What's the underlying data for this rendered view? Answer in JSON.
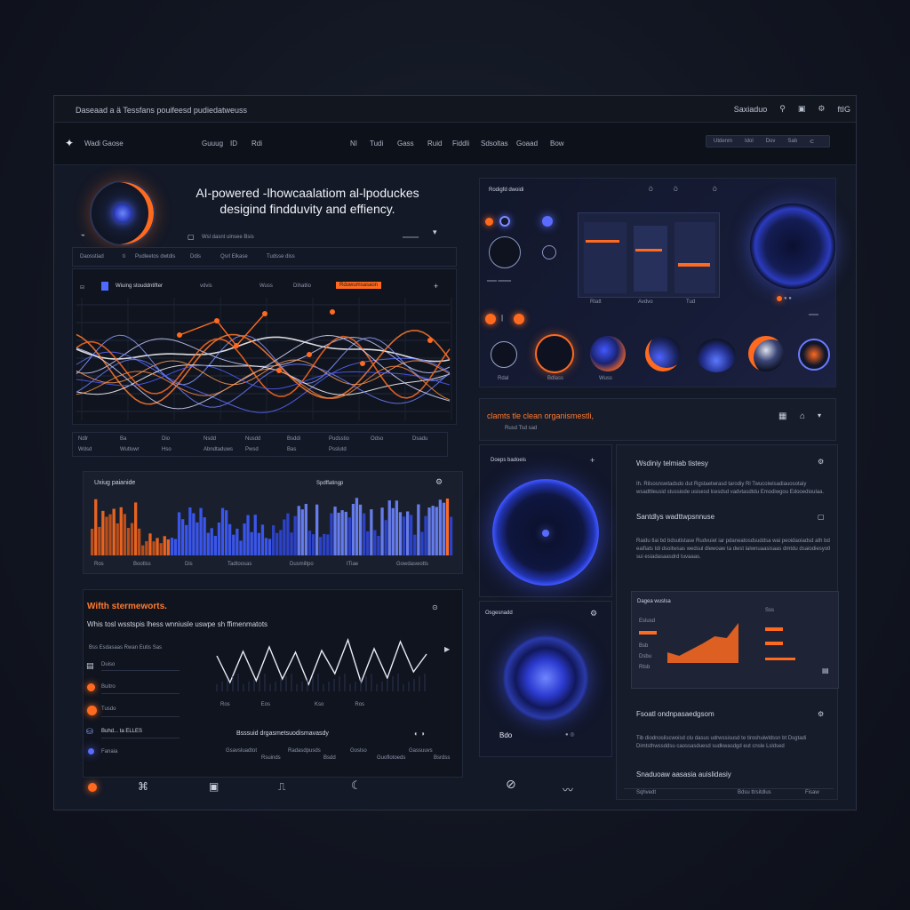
{
  "titlebar": {
    "title": "Daseaad  a  ä  Tessfans pouifeesd pudiedatweuss",
    "right_label": "Saxiaduo",
    "right_badge": "ftIG"
  },
  "navbar": {
    "brand": "Wadi Gaose",
    "items": [
      "Guuug",
      "ID",
      "Rdi",
      "NI",
      "Tudi",
      "Gass",
      "Ruid",
      "Fiddli",
      "Sdsoltas",
      "Goaad",
      "Bow"
    ],
    "search_items": [
      "Utdenm",
      "Idol",
      "Dov",
      "Sab"
    ]
  },
  "hero": {
    "title_line1": "AI-powered -lhowcaalatiom al-lpoduckes",
    "title_line2": "desigind findduvity and effiency.",
    "caption": "Wsl dasnt ulnsee Bsis",
    "toolbar": [
      "Daosstiad",
      "ti",
      "Pudleetos dwtdis",
      "Ddis",
      "Qsrl Elkase",
      "Tudsse diss"
    ]
  },
  "wave_chart": {
    "legend": [
      "Wiuing stouddntifter",
      "vdvis",
      "Wuss",
      "Dihatlio"
    ],
    "badge": "Rduwumsasaon",
    "footer_cols": [
      [
        "Ndlr",
        "Wdsd"
      ],
      [
        "Ba",
        "Wutluwr"
      ],
      [
        "Dio",
        "Hso"
      ],
      [
        "Nsdd",
        "Abndtaduws"
      ],
      [
        "Nusdd",
        "Pwsd"
      ],
      [
        "Bsddi",
        "Bas"
      ],
      [
        "Pudsstio",
        "Psslutd"
      ],
      [
        "Odso",
        ""
      ],
      [
        "Dsadu",
        ""
      ]
    ]
  },
  "bar_chart": {
    "title": "Uxiug paianide",
    "right_label": "Spdffatingp",
    "x_labels": [
      "Ros",
      "Bootlss",
      "Dis",
      "Tadtoosas",
      "Dusmiltpo",
      "ITiae",
      "Gowdaswotts"
    ]
  },
  "lower_left": {
    "title": "Wifth stermeworts.",
    "subtitle": "Whis tosl wsstspis lhess wnniusle uswpe sh ffimenmatots",
    "list_header": "Bss Esdasaas Rwan Eutis Sas",
    "list_items": [
      "Duiso",
      "Buitro",
      "Tusdo",
      "Buhd... ta ELLES",
      "Fanaia"
    ],
    "footer_title": "Bsssuid drgasmetsuodismavasdy",
    "footer_items": [
      "Gsavsluadtot",
      "Rsuinds",
      "Radasdpusds",
      "Bsdd",
      "Goslso",
      "Guoflotoeds",
      "Gassuuvs",
      "Bsrdss"
    ]
  },
  "right_top": {
    "title": "Rodigfd dwoidi",
    "top_icons": [
      "Ö",
      "Ö",
      "Ö"
    ],
    "window_labels": [
      "Rtatt",
      "Avdvo",
      "Tud"
    ],
    "ring_labels": [
      "Rdal",
      "Bdlass",
      "Wuss"
    ]
  },
  "right_section": {
    "title": "clamts tle clean organismestli,",
    "subtitle": "Rusd Tsd sad"
  },
  "orb_panel_1": {
    "title": "Doeps badoeis"
  },
  "orb_panel_2": {
    "title": "Osgesnadd",
    "value": "Bdo"
  },
  "info_panel": {
    "heading1": "Wsdiniy telmiab tistesy",
    "para1": "Ih. Rilsosnswtadsdo dut Rgstaetwrasd tarodiy Rl Twucoiwisadiauosotaiy wsadttleusid stussiode usisesd lcesdsd vadvtasdtdu Emodiwgou Edooedioulaa.",
    "heading2": "Santdlys wadttwpsnnuse",
    "para2": "Raidu tlai bd bdsutistase Rudvuiet iar pdaneatosdsuddsa wai peoidaoiadsd ath bd eaifiats tdi dsoitwsas wedsul dlewoaw ta dwst lalwnuaasisaas dmtdu dsaiodiesyotl sui esiadasaasdrd tuvaaas.",
    "heading3": "Fsoatl ondnpasaedgsom",
    "para3": "Tib diodnosliscwoisd clu dasus udrwssisusd te tiroshuiwldssn bt Dsgtadi Dimtsthwssddsu caossasduesd sudkwasdgd eut cnsle Lsldsed",
    "heading4": "Snaduoaw aasasia auislidasiy",
    "footer_items": [
      "Sqhvedt",
      "Bdsu ttrsitdlus",
      "Fisaw"
    ]
  },
  "mini_chart": {
    "title": "Dagea wuslsa",
    "labels": [
      "Eslusd",
      "Bsb",
      "Dsbu",
      "Rtsb",
      "Sss"
    ],
    "values": [
      12,
      8,
      15,
      22,
      30,
      28,
      45
    ]
  },
  "bottom_icons": [
    "power",
    "network",
    "image",
    "stats",
    "moon",
    "gauge",
    "wave"
  ]
}
